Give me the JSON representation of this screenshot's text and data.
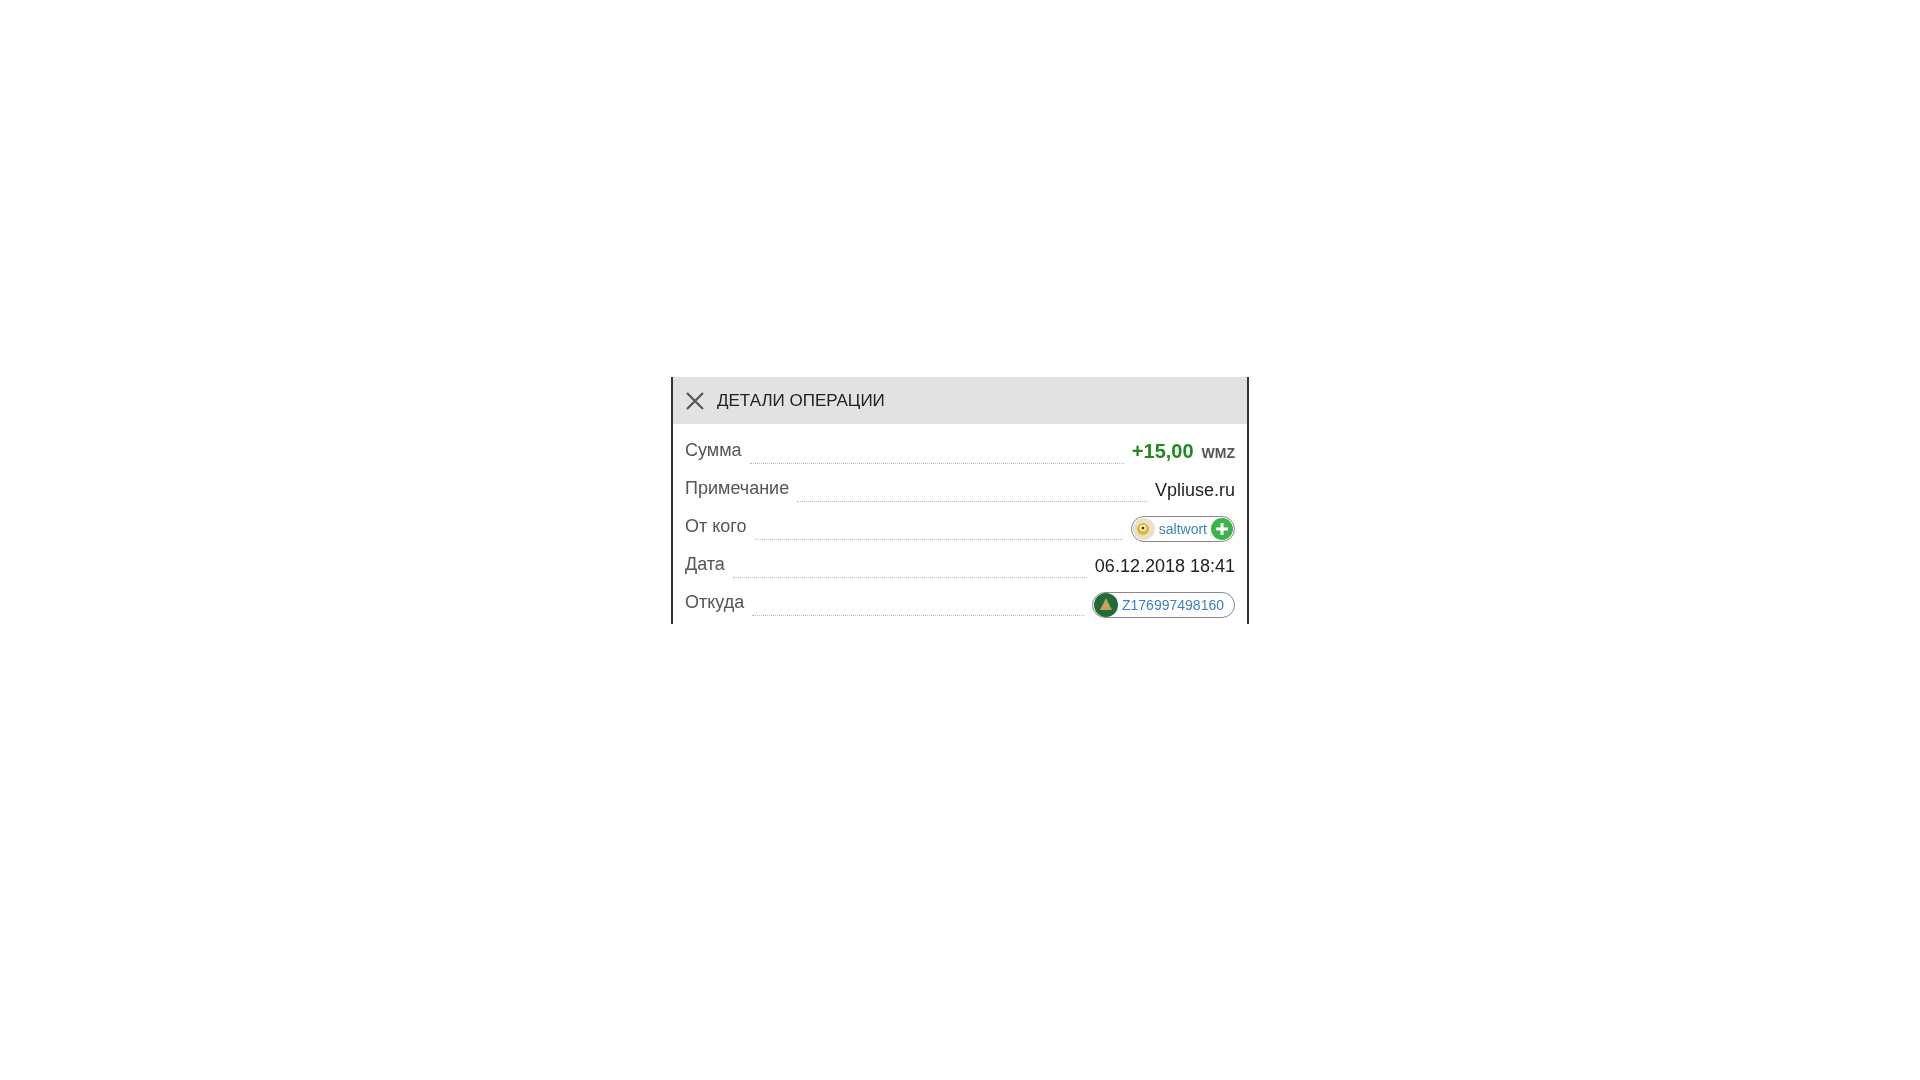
{
  "dialog": {
    "title": "ДЕТАЛИ ОПЕРАЦИИ",
    "rows": [
      {
        "kind": "amount",
        "label": "Сумма",
        "value": "+15,00",
        "unit": "WMZ"
      },
      {
        "kind": "text",
        "label": "Примечание",
        "value": "Vpliuse.ru"
      },
      {
        "kind": "contact",
        "label": "От кого",
        "value": "saltwort"
      },
      {
        "kind": "text",
        "label": "Дата",
        "value": "06.12.2018 18:41"
      },
      {
        "kind": "purse",
        "label": "Откуда",
        "value": "Z176997498160"
      }
    ]
  }
}
